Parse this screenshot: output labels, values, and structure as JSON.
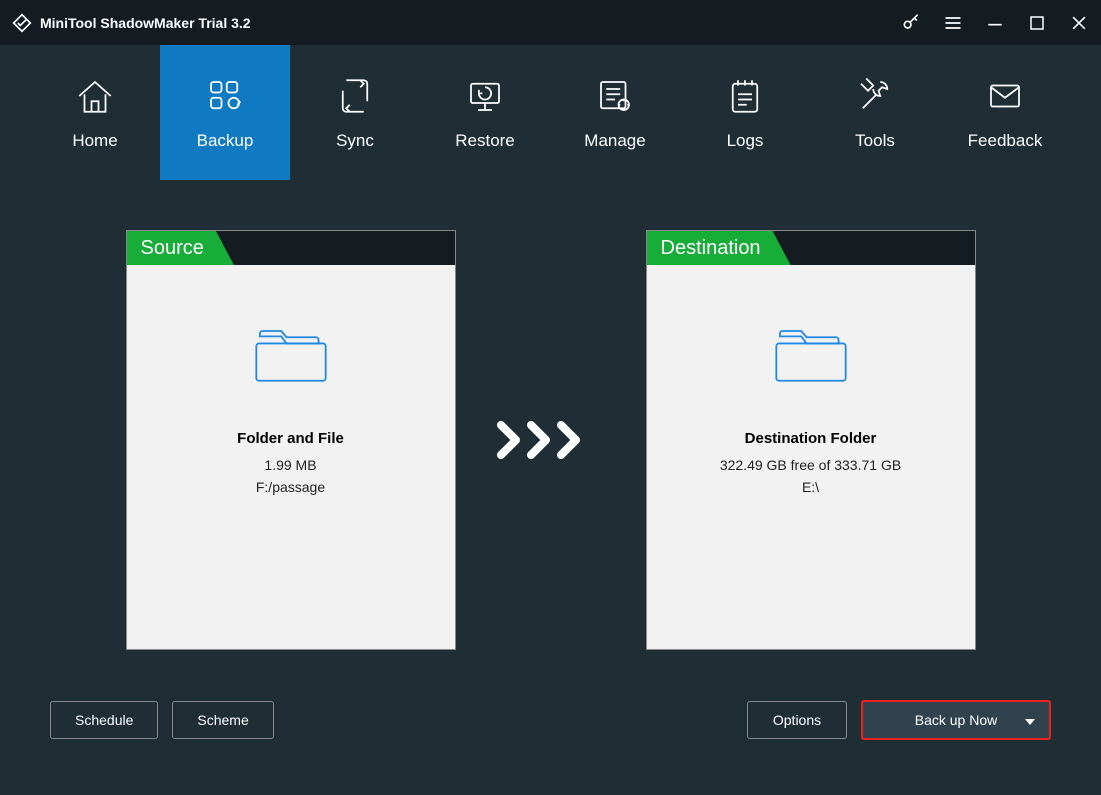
{
  "app": {
    "title": "MiniTool ShadowMaker Trial 3.2"
  },
  "nav": {
    "items": [
      {
        "label": "Home"
      },
      {
        "label": "Backup"
      },
      {
        "label": "Sync"
      },
      {
        "label": "Restore"
      },
      {
        "label": "Manage"
      },
      {
        "label": "Logs"
      },
      {
        "label": "Tools"
      },
      {
        "label": "Feedback"
      }
    ]
  },
  "source": {
    "header": "Source",
    "title": "Folder and File",
    "size": "1.99 MB",
    "path": "F:/passage"
  },
  "destination": {
    "header": "Destination",
    "title": "Destination Folder",
    "info": "322.49 GB free of 333.71 GB",
    "path": "E:\\"
  },
  "footer": {
    "schedule": "Schedule",
    "scheme": "Scheme",
    "options": "Options",
    "backup": "Back up Now"
  }
}
